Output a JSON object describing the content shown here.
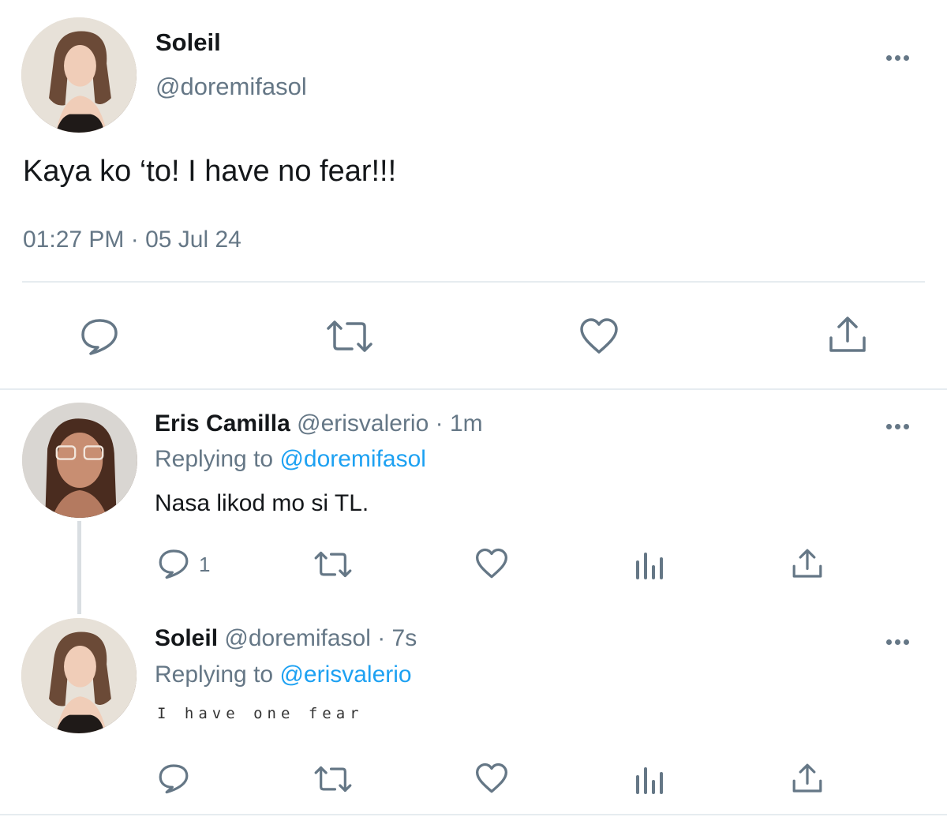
{
  "main_tweet": {
    "display_name": "Soleil",
    "handle": "@doremifasol",
    "text": "Kaya ko ‘to! I have no fear!!!",
    "timestamp": "01:27 PM · 05 Jul 24"
  },
  "reply_1": {
    "display_name": "Eris Camilla",
    "handle_time": "@erisvalerio · 1m",
    "replying_prefix": "Replying to",
    "replying_handle": "@doremifasol",
    "text": "Nasa likod mo si TL.",
    "reply_count": "1"
  },
  "reply_2": {
    "display_name": "Soleil",
    "handle_time": "@doremifasol · 7s",
    "replying_prefix": "Replying to",
    "replying_handle": "@erisvalerio",
    "text": "I have one fear"
  },
  "colors": {
    "icon_gray": "#657786",
    "link_blue": "#1da1f2",
    "divider": "#e6ecf0"
  },
  "icons": [
    "more-icon",
    "reply-icon",
    "retweet-icon",
    "like-icon",
    "share-icon",
    "analytics-icon"
  ]
}
